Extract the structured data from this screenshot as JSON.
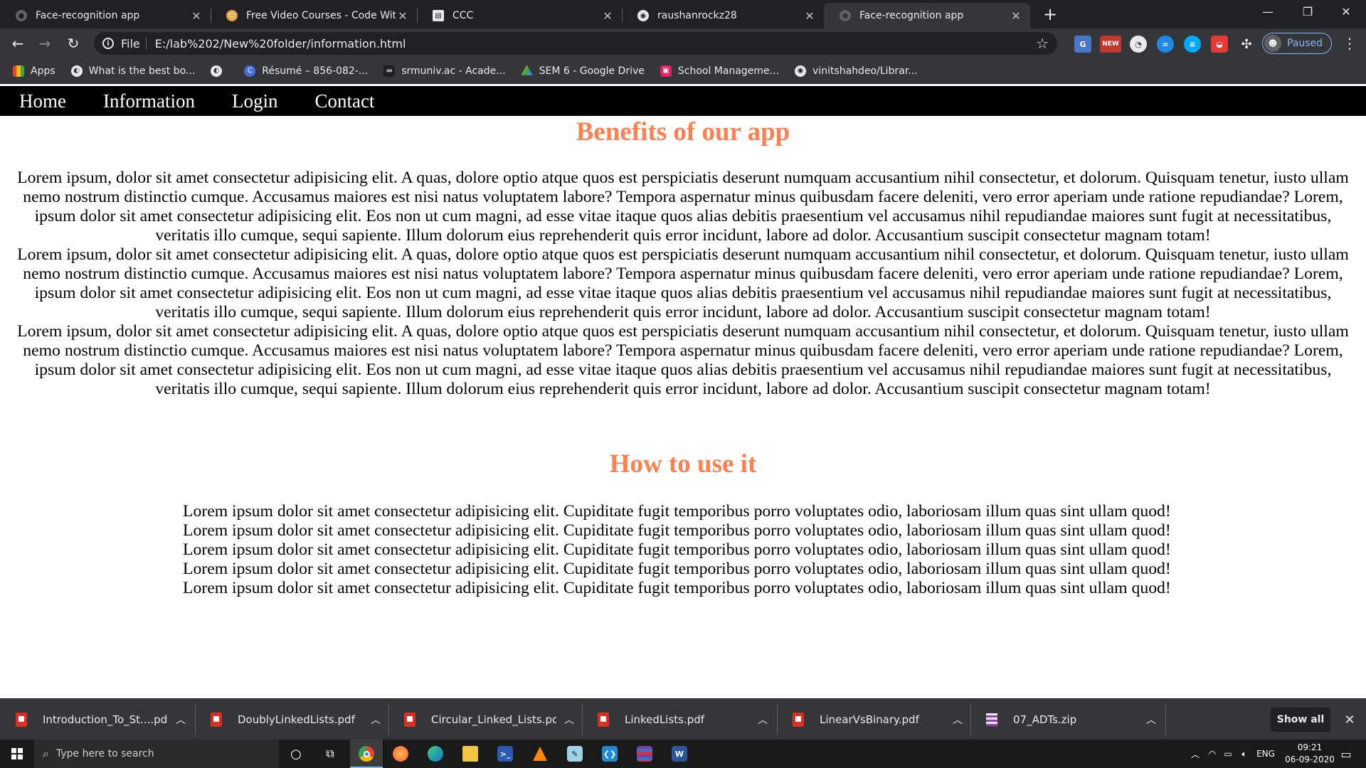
{
  "browser": {
    "tabs": [
      {
        "title": "Face-recognition app",
        "icon": "globe-icon"
      },
      {
        "title": "Free Video Courses - Code With",
        "icon": "codewith-icon"
      },
      {
        "title": "CCC",
        "icon": "page-icon"
      },
      {
        "title": "raushanrockz28",
        "icon": "github-icon"
      },
      {
        "title": "Face-recognition app",
        "icon": "globe-icon",
        "active": true
      }
    ],
    "new_tab": "+",
    "address": {
      "scheme": "File",
      "url": "E:/lab%202/New%20folder/information.html"
    },
    "profile_status": "Paused",
    "extension_badge": "NEW"
  },
  "bookmarks": [
    {
      "label": "Apps",
      "icon": "apps-grid-icon"
    },
    {
      "label": "What is the best bo...",
      "icon": "globe-icon"
    },
    {
      "label": "",
      "icon": "globe-icon"
    },
    {
      "label": "Résumé – 856-082-...",
      "icon": "c-icon"
    },
    {
      "label": "srmuniv.ac - Acade...",
      "icon": "srm-icon"
    },
    {
      "label": "SEM 6 - Google Drive",
      "icon": "drive-icon"
    },
    {
      "label": "School Manageme...",
      "icon": "school-icon"
    },
    {
      "label": "vinitshahdeo/Librar...",
      "icon": "github-icon"
    }
  ],
  "site": {
    "nav": [
      "Home",
      "Information",
      "Login",
      "Contact"
    ],
    "sections": [
      {
        "title": "Benefits of our app",
        "paragraphs": [
          "Lorem ipsum, dolor sit amet consectetur adipisicing elit. A quas, dolore optio atque quos est perspiciatis deserunt numquam accusantium nihil consectetur, et dolorum. Quisquam tenetur, iusto ullam nemo nostrum distinctio cumque. Accusamus maiores est nisi natus voluptatem labore? Tempora aspernatur minus quibusdam facere deleniti, vero error aperiam unde ratione repudiandae? Lorem, ipsum dolor sit amet consectetur adipisicing elit. Eos non ut cum magni, ad esse vitae itaque quos alias debitis praesentium vel accusamus nihil repudiandae maiores sunt fugit at necessitatibus, veritatis illo cumque, sequi sapiente. Illum dolorum eius reprehenderit quis error incidunt, labore ad dolor. Accusantium suscipit consectetur magnam totam!",
          "Lorem ipsum, dolor sit amet consectetur adipisicing elit. A quas, dolore optio atque quos est perspiciatis deserunt numquam accusantium nihil consectetur, et dolorum. Quisquam tenetur, iusto ullam nemo nostrum distinctio cumque. Accusamus maiores est nisi natus voluptatem labore? Tempora aspernatur minus quibusdam facere deleniti, vero error aperiam unde ratione repudiandae? Lorem, ipsum dolor sit amet consectetur adipisicing elit. Eos non ut cum magni, ad esse vitae itaque quos alias debitis praesentium vel accusamus nihil repudiandae maiores sunt fugit at necessitatibus, veritatis illo cumque, sequi sapiente. Illum dolorum eius reprehenderit quis error incidunt, labore ad dolor. Accusantium suscipit consectetur magnam totam!",
          "Lorem ipsum, dolor sit amet consectetur adipisicing elit. A quas, dolore optio atque quos est perspiciatis deserunt numquam accusantium nihil consectetur, et dolorum. Quisquam tenetur, iusto ullam nemo nostrum distinctio cumque. Accusamus maiores est nisi natus voluptatem labore? Tempora aspernatur minus quibusdam facere deleniti, vero error aperiam unde ratione repudiandae? Lorem, ipsum dolor sit amet consectetur adipisicing elit. Eos non ut cum magni, ad esse vitae itaque quos alias debitis praesentium vel accusamus nihil repudiandae maiores sunt fugit at necessitatibus, veritatis illo cumque, sequi sapiente. Illum dolorum eius reprehenderit quis error incidunt, labore ad dolor. Accusantium suscipit consectetur magnam totam!"
        ]
      },
      {
        "title": "How to use it",
        "lines": [
          "Lorem ipsum dolor sit amet consectetur adipisicing elit. Cupiditate fugit temporibus porro voluptates odio, laboriosam illum quas sint ullam quod!",
          "Lorem ipsum dolor sit amet consectetur adipisicing elit. Cupiditate fugit temporibus porro voluptates odio, laboriosam illum quas sint ullam quod!",
          "Lorem ipsum dolor sit amet consectetur adipisicing elit. Cupiditate fugit temporibus porro voluptates odio, laboriosam illum quas sint ullam quod!",
          "Lorem ipsum dolor sit amet consectetur adipisicing elit. Cupiditate fugit temporibus porro voluptates odio, laboriosam illum quas sint ullam quod!",
          "Lorem ipsum dolor sit amet consectetur adipisicing elit. Cupiditate fugit temporibus porro voluptates odio, laboriosam illum quas sint ullam quod!"
        ]
      }
    ],
    "accent_color": "#ff7f50"
  },
  "downloads": {
    "items": [
      {
        "name": "Introduction_To_St....pdf",
        "type": "pdf"
      },
      {
        "name": "DoublyLinkedLists.pdf",
        "type": "pdf"
      },
      {
        "name": "Circular_Linked_Lists.pdf",
        "type": "pdf"
      },
      {
        "name": "LinkedLists.pdf",
        "type": "pdf"
      },
      {
        "name": "LinearVsBinary.pdf",
        "type": "pdf"
      },
      {
        "name": "07_ADTs.zip",
        "type": "zip"
      }
    ],
    "show_all": "Show all"
  },
  "taskbar": {
    "search_placeholder": "Type here to search",
    "apps": [
      "cortana-icon",
      "task-view-icon",
      "chrome-icon",
      "firefox-icon",
      "edge-icon",
      "file-explorer-icon",
      "powershell-icon",
      "vlc-icon",
      "notepad-icon",
      "vscode-icon",
      "winrar-icon",
      "word-icon"
    ],
    "language": "ENG",
    "time": "09:21",
    "date": "06-09-2020"
  }
}
